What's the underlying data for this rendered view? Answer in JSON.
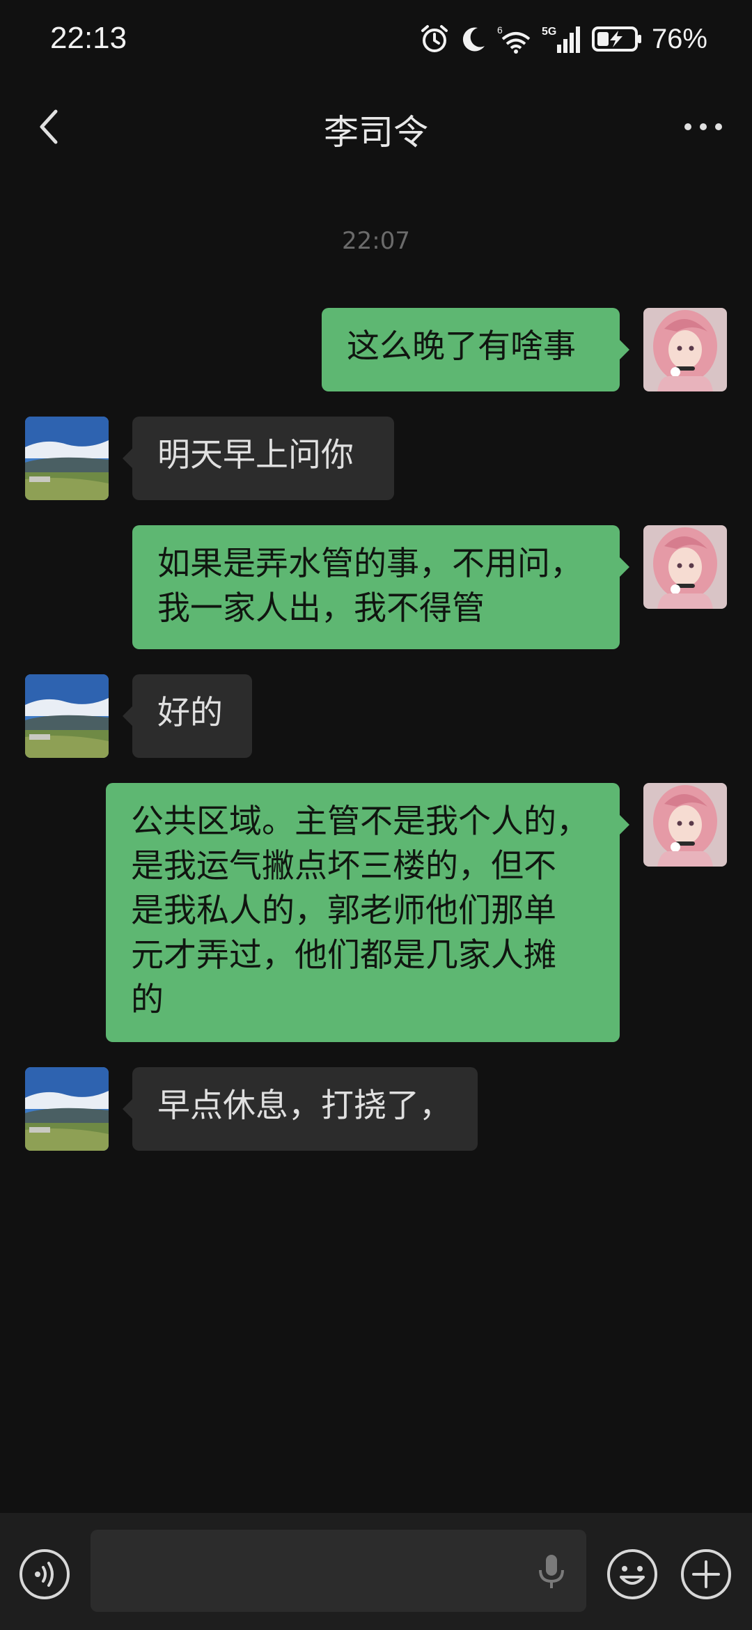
{
  "status_bar": {
    "time": "22:13",
    "battery_percent": "76%",
    "icons": [
      "alarm-icon",
      "moon-icon",
      "wifi-icon",
      "5g-signal-icon",
      "battery-charging-icon"
    ]
  },
  "header": {
    "title": "李司令",
    "back_icon": "chevron-left-icon",
    "more_icon": "more-dots-icon"
  },
  "chat": {
    "timestamp": "22:07",
    "messages": [
      {
        "side": "out",
        "text": "这么晚了有啥事"
      },
      {
        "side": "in",
        "text": "明天早上问你"
      },
      {
        "side": "out",
        "lines": [
          "如果是弄水管的事，不用问，",
          "我一家人出，我不得管"
        ]
      },
      {
        "side": "in",
        "text": "好的"
      },
      {
        "side": "out",
        "lines": [
          "公共区域。主管不是我个人的，",
          "是我运气撇点坏三楼的，但不",
          "是我私人的，郭老师他们那单",
          "元才弄过，他们都是几家人摊",
          "的"
        ]
      },
      {
        "side": "in",
        "text": "早点休息，打挠了，"
      }
    ]
  },
  "input_bar": {
    "left_icon": "voice-icon",
    "field_icon": "microphone-icon",
    "emoji_icon": "emoji-icon",
    "plus_icon": "plus-circle-icon"
  },
  "colors": {
    "background": "#111111",
    "outgoing_bubble": "#5eb772",
    "incoming_bubble": "#2c2c2c",
    "input_bar": "#1e1e1e"
  }
}
